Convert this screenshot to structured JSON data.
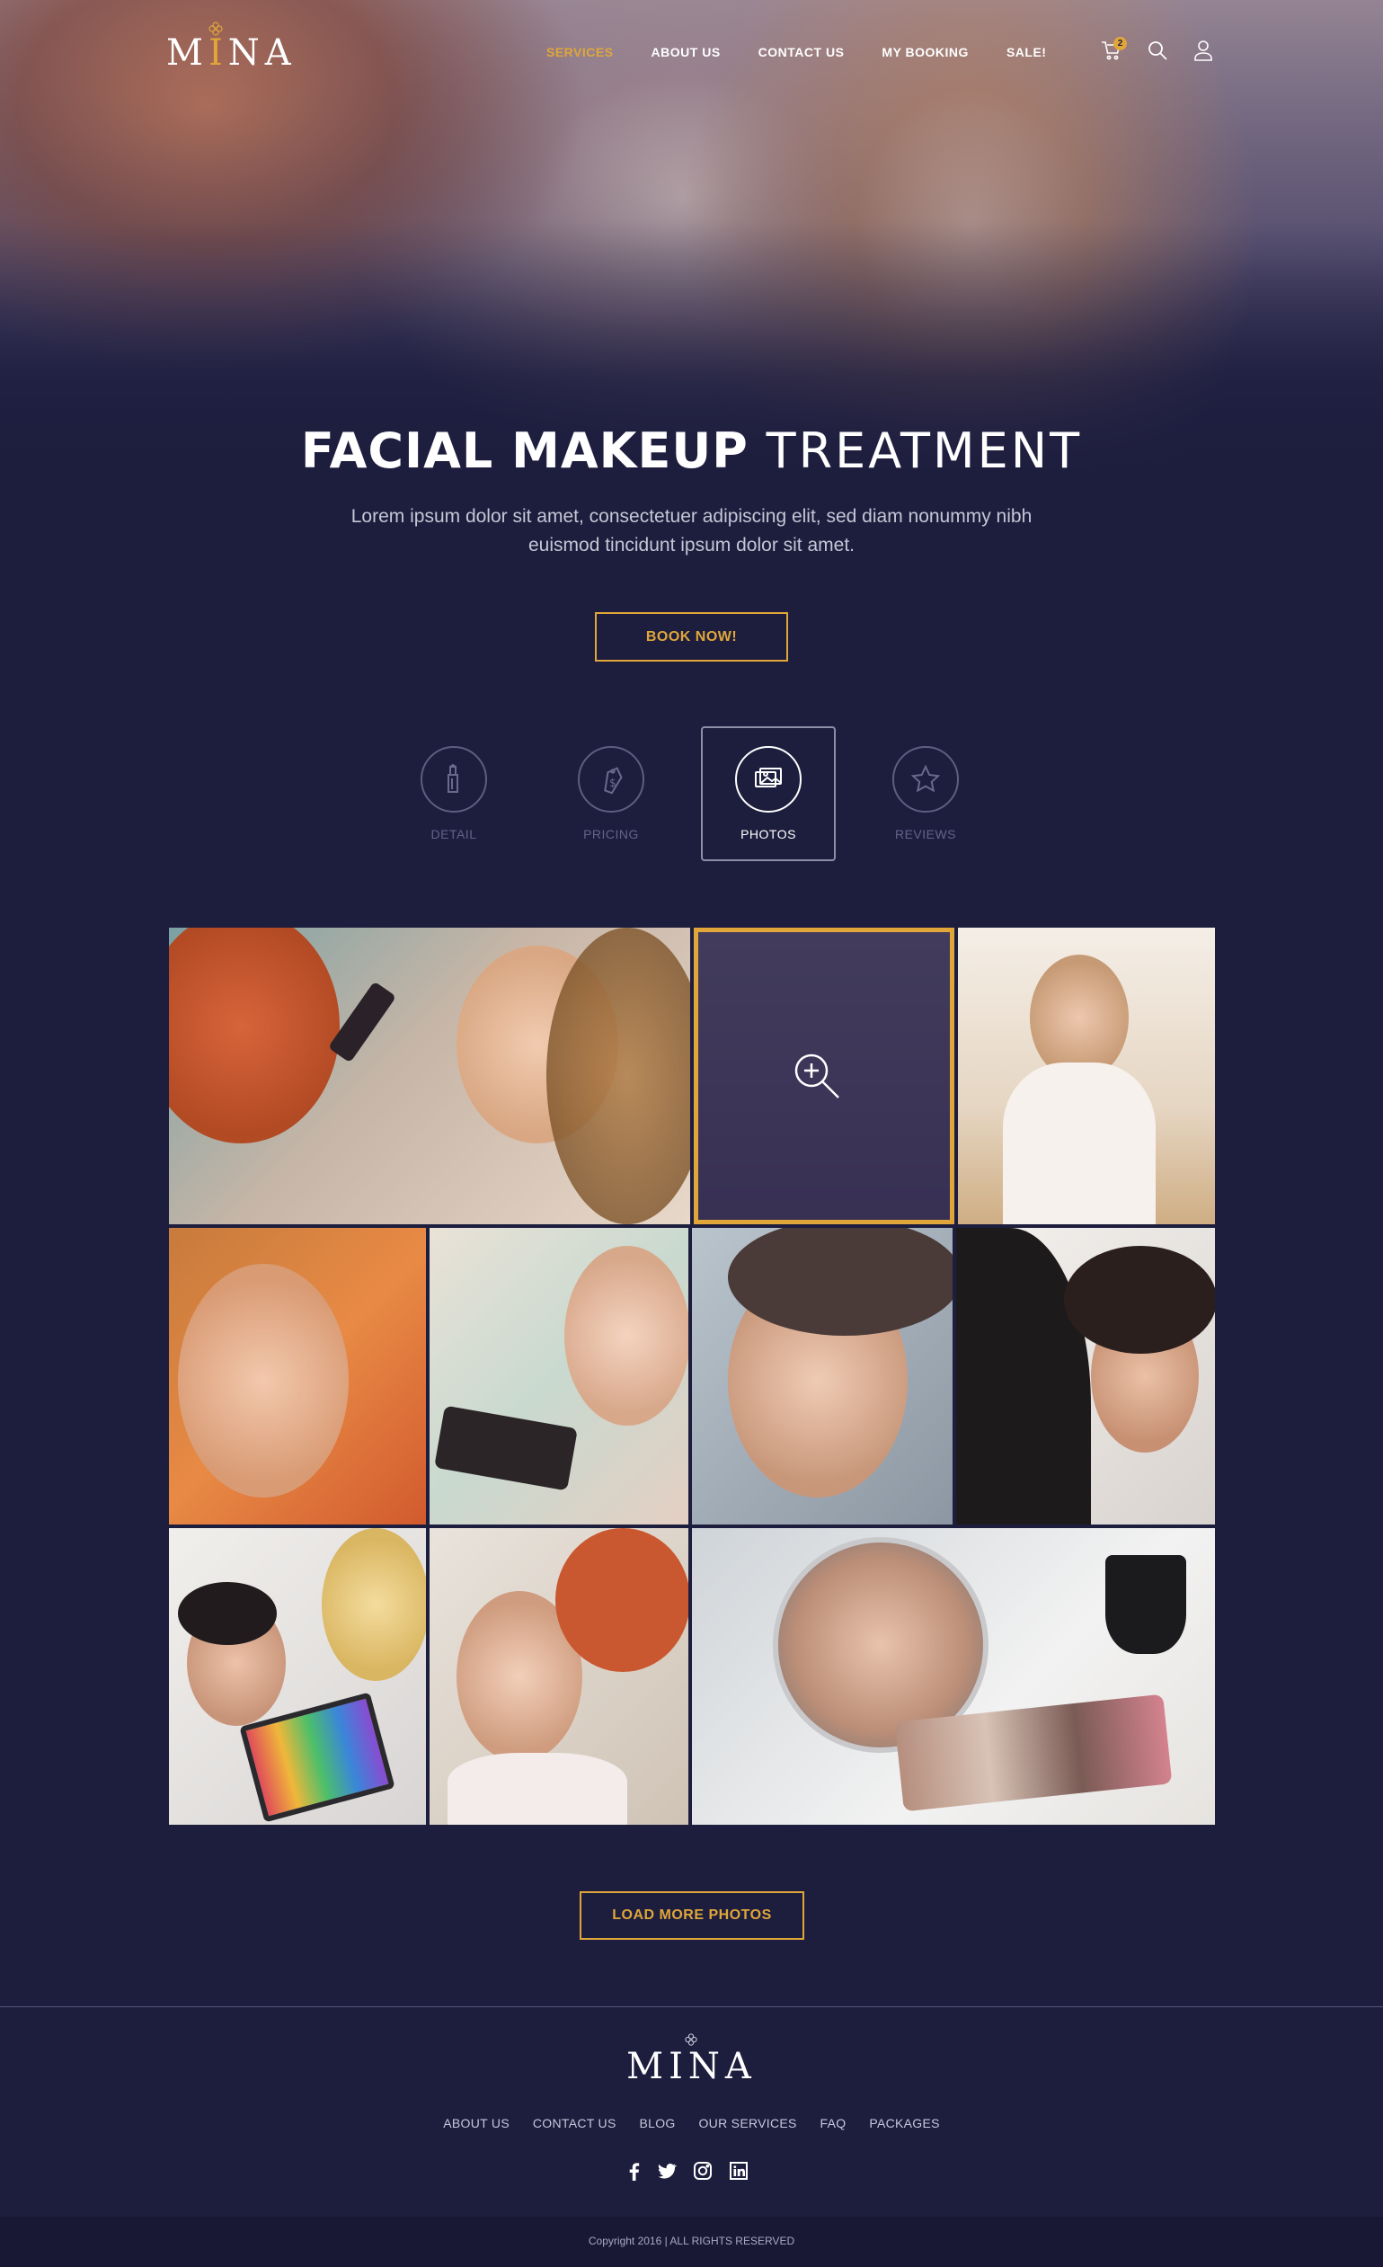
{
  "brand": {
    "name": "Mina",
    "logo_text": "MINA"
  },
  "nav": {
    "items": [
      "SERVICES",
      "ABOUT US",
      "CONTACT US",
      "MY BOOKING",
      "SALE!"
    ],
    "active": "SERVICES",
    "cart_count": "2",
    "icons": [
      "cart-icon",
      "search-icon",
      "user-icon"
    ]
  },
  "hero": {
    "title_bold": "FACIAL MAKEUP",
    "title_light": "TREATMENT",
    "subtitle": "Lorem ipsum dolor sit amet, consectetuer adipiscing elit, sed diam nonummy nibh euismod tincidunt ipsum dolor sit amet.",
    "cta": "BOOK NOW!"
  },
  "tabs": [
    {
      "label": "DETAIL",
      "icon": "lipstick-icon"
    },
    {
      "label": "PRICING",
      "icon": "price-tag-icon"
    },
    {
      "label": "PHOTOS",
      "icon": "photos-icon",
      "active": true
    },
    {
      "label": "REVIEWS",
      "icon": "star-icon"
    }
  ],
  "gallery": {
    "photo_count": 11,
    "hover_icon": "zoom-in-icon",
    "load_more": "LOAD MORE PHOTOS"
  },
  "footer": {
    "links": [
      "ABOUT US",
      "CONTACT US",
      "BLOG",
      "OUR SERVICES",
      "FAQ",
      "PACKAGES"
    ],
    "social": [
      "facebook-icon",
      "twitter-icon",
      "instagram-icon",
      "linkedin-icon"
    ],
    "copyright": "Copyright 2016 | ALL RIGHTS RESERVED"
  },
  "colors": {
    "background": "#1d1d3e",
    "accent": "#e0a63a",
    "text": "#ffffff",
    "muted": "#64648a"
  }
}
